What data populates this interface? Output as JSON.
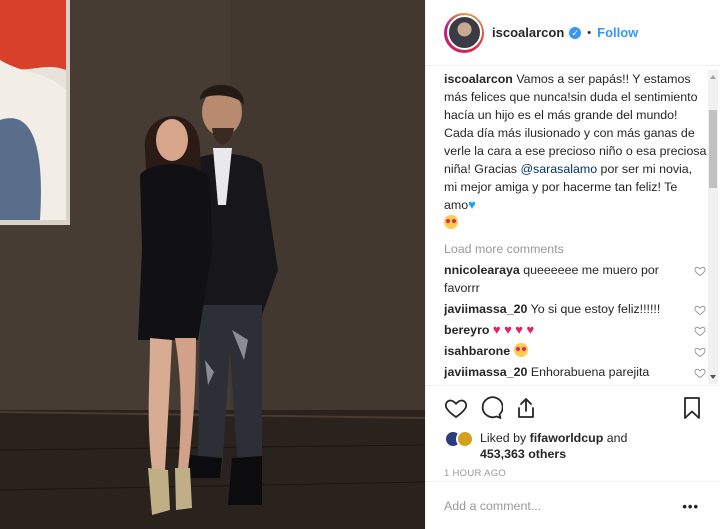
{
  "post": {
    "username": "iscoalarcon",
    "dot": "•",
    "follow_label": "Follow",
    "caption_text": "Vamos a ser papás!! Y estamos más felices que nunca!sin duda el sentimiento hacía un hijo es el más grande del mundo! Cada día más ilusionado y con más ganas de verle la cara a ese precioso niño o esa preciosa niña! Gracias",
    "caption_tag": "@sarasalamo",
    "caption_text2": "por ser mi novia, mi mejor amiga y por hacerme tan feliz! Te amo",
    "load_more": "Load more comments",
    "comments": [
      {
        "user": "nnicolearaya",
        "text": "queeeeee me muero por favorrr"
      },
      {
        "user": "javiimassa_20",
        "text": "Yo si que estoy feliz!!!!!!"
      },
      {
        "user": "bereyro",
        "text": ""
      },
      {
        "user": "isahbarone",
        "text": ""
      },
      {
        "user": "javiimassa_20",
        "text": "Enhorabuena parejita"
      }
    ],
    "liked_prefix": "Liked by",
    "liked_user": "fifaworldcup",
    "liked_and": "and",
    "liked_count": "453,363 others",
    "time_ago": "1 HOUR AGO",
    "add_comment_placeholder": "Add a comment...",
    "more_options": "•••"
  },
  "icons": [
    "verified-icon",
    "heart-icon",
    "comment-icon",
    "share-icon",
    "bookmark-icon",
    "small-heart-icon",
    "heart-emoji",
    "blue-heart-emoji",
    "heart-eyes-emoji"
  ],
  "colors": {
    "accent": "#3897f0",
    "text": "#262626",
    "muted": "#999999",
    "tag": "#003569"
  }
}
